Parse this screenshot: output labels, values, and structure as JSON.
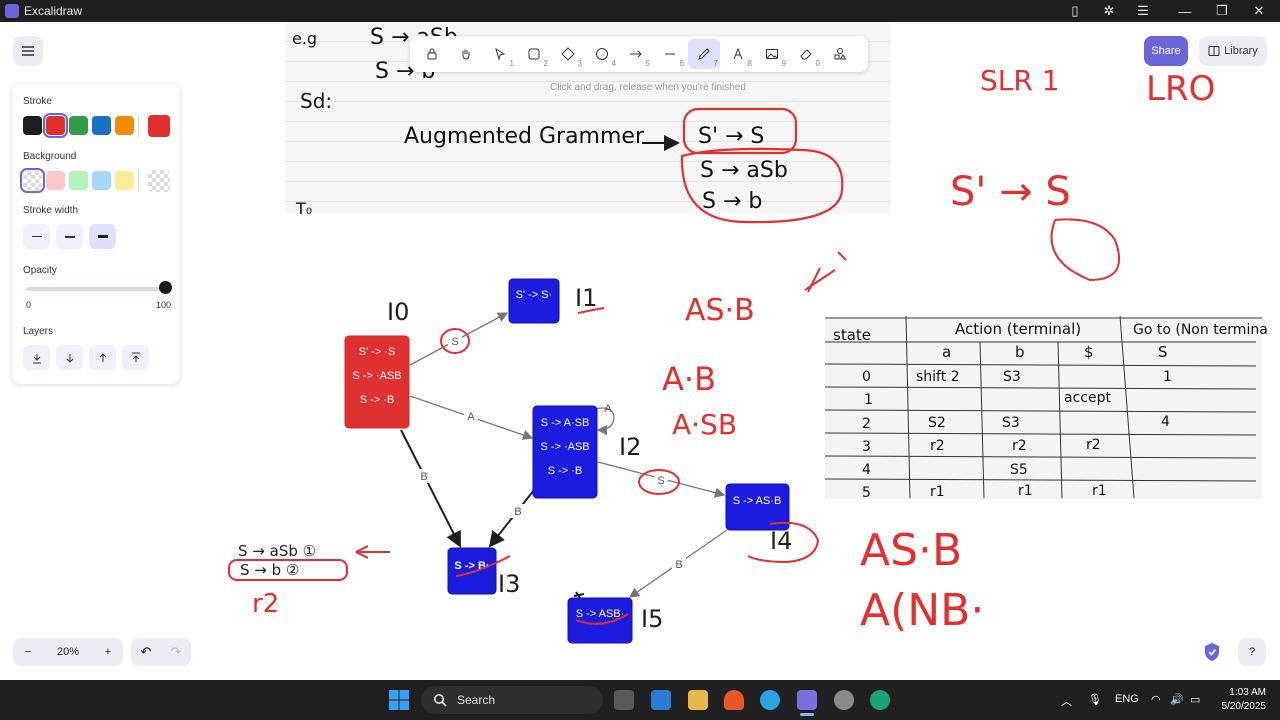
{
  "window": {
    "title": "Excalidraw"
  },
  "toolbar": {
    "tools": [
      {
        "name": "lock",
        "num": ""
      },
      {
        "name": "hand",
        "num": ""
      },
      {
        "name": "selection",
        "num": "1"
      },
      {
        "name": "rectangle",
        "num": "2"
      },
      {
        "name": "diamond",
        "num": "3"
      },
      {
        "name": "ellipse",
        "num": "4"
      },
      {
        "name": "arrow",
        "num": "5"
      },
      {
        "name": "line",
        "num": "6"
      },
      {
        "name": "draw",
        "num": "7"
      },
      {
        "name": "text",
        "num": "8"
      },
      {
        "name": "image",
        "num": "9"
      },
      {
        "name": "eraser",
        "num": "0"
      },
      {
        "name": "extra-tools",
        "num": ""
      }
    ],
    "hint": "Click and drag, release when you're finished"
  },
  "panel": {
    "stroke_label": "Stroke",
    "stroke_colors": [
      "#1e1e1e",
      "#e03131",
      "#2f9e44",
      "#1971c2",
      "#f08c00"
    ],
    "stroke_current": "#e03131",
    "background_label": "Background",
    "background_colors": [
      "transparent",
      "#ffc9c9",
      "#b2f2bb",
      "#a5d8ff",
      "#ffec99"
    ],
    "stroke_width_label": "Stroke width",
    "opacity_label": "Opacity",
    "opacity_min": "0",
    "opacity_max": "100",
    "opacity_value": 100,
    "layers_label": "Layers"
  },
  "header": {
    "share": "Share",
    "library": "Library"
  },
  "footer": {
    "zoom_out": "−",
    "zoom": "20%",
    "zoom_in": "+",
    "undo": "↶",
    "redo": "↷",
    "help": "?"
  },
  "diagram": {
    "states": [
      {
        "id": "I0",
        "lines": [
          "S' -> ·S",
          "S -> ·ASB",
          "S -> ·B"
        ]
      },
      {
        "id": "I1",
        "lines": [
          "S' -> S·"
        ]
      },
      {
        "id": "I2",
        "lines": [
          "S -> A·SB",
          "S -> ·ASB",
          "S -> ·B"
        ]
      },
      {
        "id": "I3",
        "lines": [
          "S -> B·"
        ]
      },
      {
        "id": "I4",
        "lines": [
          "S -> AS·B"
        ]
      },
      {
        "id": "I5",
        "lines": [
          "S -> ASB·"
        ]
      }
    ],
    "edges": [
      "S",
      "A",
      "B",
      "B",
      "A",
      "S",
      "B"
    ]
  },
  "notes": {
    "photo_top": [
      "Sd:",
      "Augmented Grammer",
      "S' → S",
      "S → aSb",
      "S → b"
    ],
    "right": [
      "SLR 1",
      "LRO",
      "S' → S",
      "AS·B",
      "A·B",
      "A·SB"
    ],
    "grammar": [
      "S → aSb ①",
      "S → b ②",
      "r2"
    ],
    "bottom_right": [
      "AS·B",
      "A(NB·"
    ]
  },
  "parse_table": {
    "col_state": "state",
    "col_action": "Action (terminal)",
    "col_goto": "Go to (Non termina",
    "terminals": [
      "a",
      "b",
      "$"
    ],
    "nonterminals": [
      "S"
    ],
    "rows": [
      {
        "state": "0",
        "a": "shift 2",
        "b": "S3",
        "$": "",
        "S": "1"
      },
      {
        "state": "1",
        "a": "",
        "b": "",
        "$": "accept",
        "S": ""
      },
      {
        "state": "2",
        "a": "S2",
        "b": "S3",
        "$": "",
        "S": "4"
      },
      {
        "state": "3",
        "a": "r2",
        "b": "r2",
        "$": "r2",
        "S": ""
      },
      {
        "state": "4",
        "a": "",
        "b": "S5",
        "$": "",
        "S": ""
      },
      {
        "state": "5",
        "a": "r1",
        "b": "r1",
        "$": "r1",
        "S": ""
      }
    ]
  },
  "taskbar": {
    "search": "Search",
    "lang": "ENG",
    "time": "1:03 AM",
    "date": "5/20/2025"
  }
}
